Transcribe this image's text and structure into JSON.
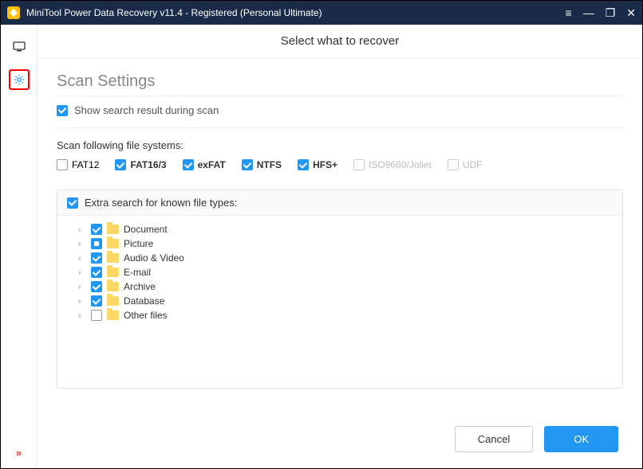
{
  "title": "MiniTool Power Data Recovery v11.4 - Registered (Personal Ultimate)",
  "page_header": "Select what to recover",
  "section_title": "Scan Settings",
  "show_search_label": "Show search result during scan",
  "fs_label": "Scan following file systems:",
  "fs": [
    {
      "label": "FAT12",
      "checked": false,
      "bold": false
    },
    {
      "label": "FAT16/3",
      "checked": true,
      "bold": true
    },
    {
      "label": "exFAT",
      "checked": true,
      "bold": true
    },
    {
      "label": "NTFS",
      "checked": true,
      "bold": true
    },
    {
      "label": "HFS+",
      "checked": true,
      "bold": true
    },
    {
      "label": "ISO9660/Joliet",
      "checked": false,
      "disabled": true
    },
    {
      "label": "UDF",
      "checked": false,
      "disabled": true
    }
  ],
  "extra_label": "Extra search for known file types:",
  "tree": [
    {
      "label": "Document",
      "state": "checked"
    },
    {
      "label": "Picture",
      "state": "indet"
    },
    {
      "label": "Audio & Video",
      "state": "checked"
    },
    {
      "label": "E-mail",
      "state": "checked"
    },
    {
      "label": "Archive",
      "state": "checked"
    },
    {
      "label": "Database",
      "state": "checked"
    },
    {
      "label": "Other files",
      "state": "unchecked"
    }
  ],
  "cancel": "Cancel",
  "ok": "OK"
}
